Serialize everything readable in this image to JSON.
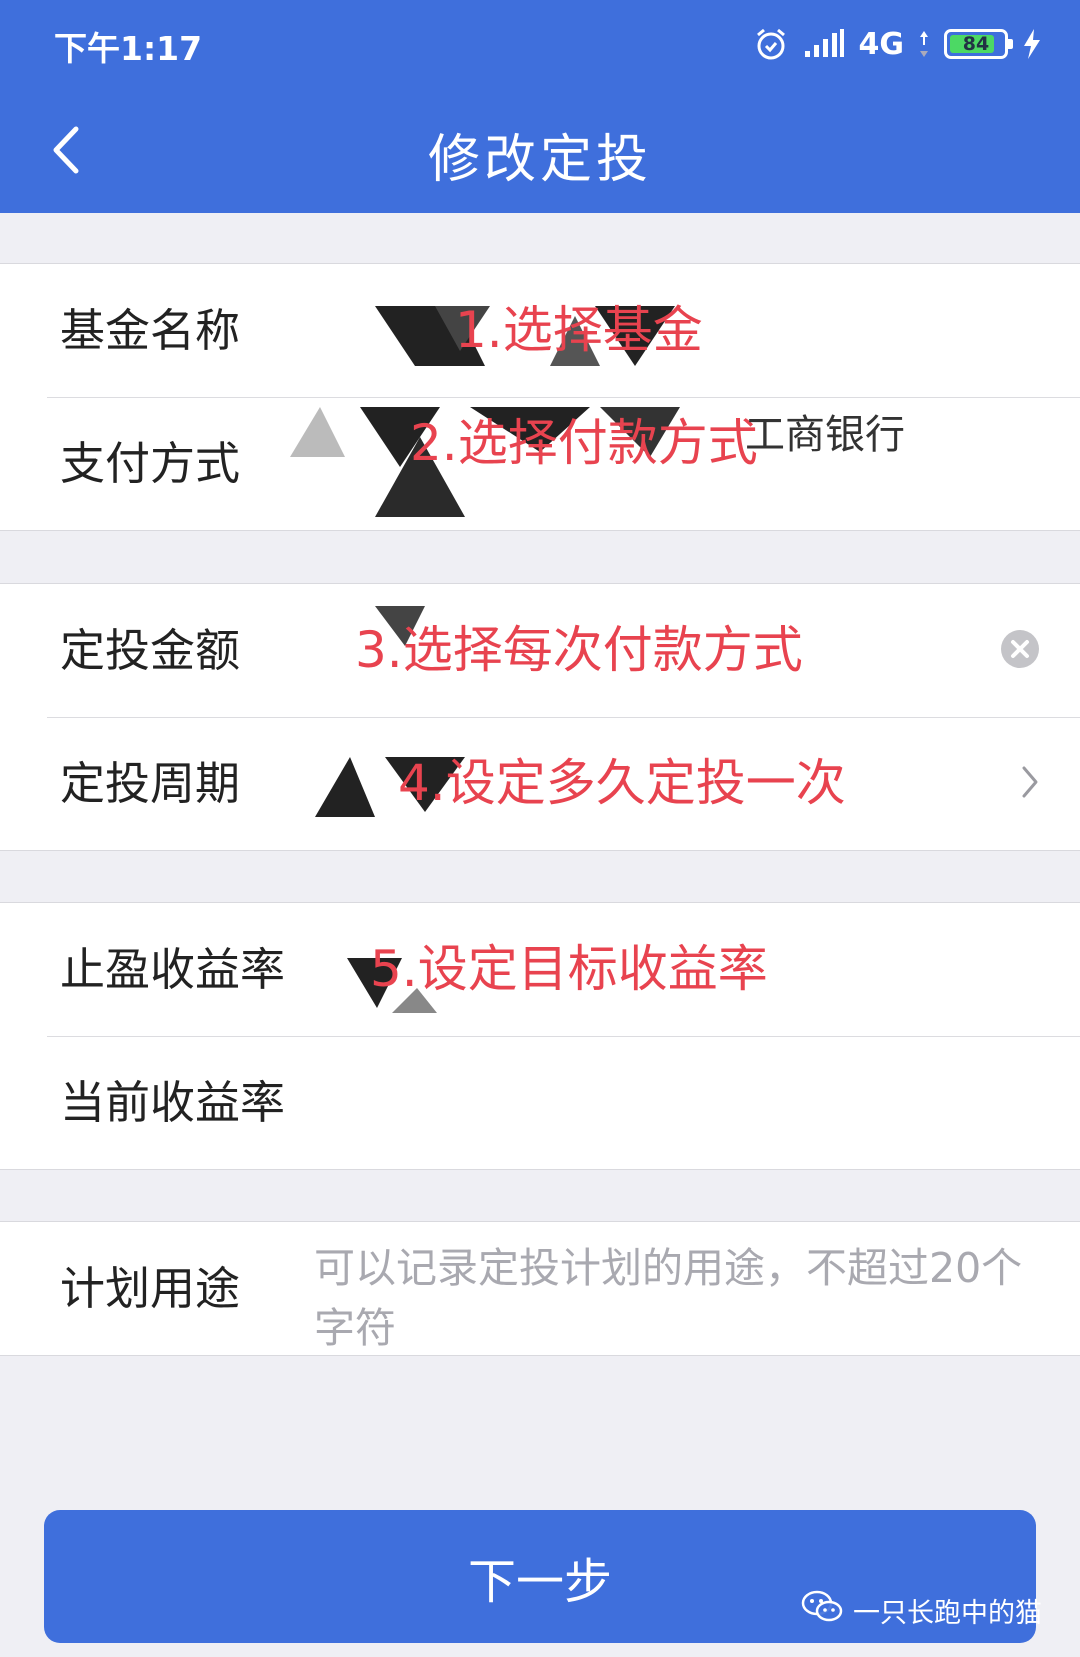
{
  "status_bar": {
    "time": "下午1:17",
    "network": "4G",
    "battery": "84",
    "battery_level": 0.84
  },
  "nav": {
    "title": "修改定投",
    "back_icon": "chevron-left-icon"
  },
  "form": {
    "fund_name": {
      "label": "基金名称",
      "annotation": "1.选择基金"
    },
    "payment_method": {
      "label": "支付方式",
      "annotation": "2.选择付款方式",
      "value": "工商银行"
    },
    "amount": {
      "label": "定投金额",
      "annotation": "3.选择每次付款方式"
    },
    "period": {
      "label": "定投周期",
      "annotation": "4.设定多久定投一次"
    },
    "stop_profit_rate": {
      "label": "止盈收益率",
      "annotation": "5.设定目标收益率"
    },
    "current_rate": {
      "label": "当前收益率"
    },
    "purpose": {
      "label": "计划用途",
      "placeholder": "可以记录定投计划的用途，不超过20个字符"
    }
  },
  "next_button": {
    "label": "下一步"
  },
  "watermark": {
    "text": "一只长跑中的猫"
  },
  "colors": {
    "primary": "#3f6fdc",
    "annotation": "#e8434f",
    "background": "#efeff4"
  }
}
